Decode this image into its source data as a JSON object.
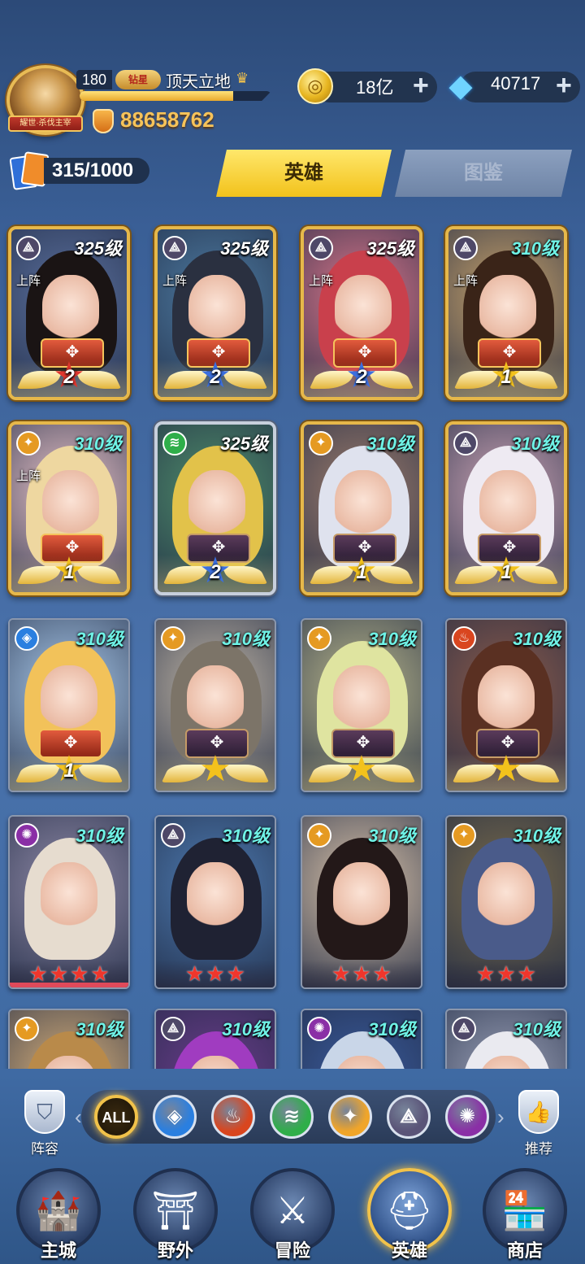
{
  "player": {
    "level": "180",
    "vip_label": "钻星",
    "nickname": "顶天立地",
    "title_banner": "耀世·杀伐主宰",
    "exp_fraction": 0.8,
    "power": "88658762"
  },
  "resources": {
    "gold": "18亿",
    "gems": "40717",
    "plus": "+"
  },
  "deck": {
    "count": "315/1000"
  },
  "tabs": [
    {
      "label": "英雄",
      "active": true
    },
    {
      "label": "图鉴",
      "active": false
    }
  ],
  "heroes": [
    {
      "level": "325级",
      "faction": "void-icon",
      "deployed": "上阵",
      "rank": "2",
      "rank_color": "red",
      "frame": "gold",
      "hair": "#1a1414",
      "bg": "#5a6f9c"
    },
    {
      "level": "325级",
      "faction": "void-icon",
      "deployed": "上阵",
      "rank": "2",
      "rank_color": "blue",
      "frame": "gold",
      "hair": "#2a3040",
      "bg": "#4d7aa0"
    },
    {
      "level": "325级",
      "faction": "void-icon",
      "deployed": "上阵",
      "rank": "2",
      "rank_color": "blue",
      "frame": "gold",
      "hair": "#c9404c",
      "bg": "#d9768a"
    },
    {
      "level": "310级",
      "faction": "void-icon",
      "deployed": "上阵",
      "rank": "1",
      "rank_color": "gold",
      "frame": "gold",
      "hair": "#3a2418",
      "bg": "#c7a16a"
    },
    {
      "level": "310级",
      "faction": "light-icon",
      "deployed": "上阵",
      "rank": "1",
      "rank_color": "gold",
      "frame": "gold",
      "hair": "#eed7a0",
      "bg": "#e9c3c8"
    },
    {
      "level": "325级",
      "faction": "nature-icon",
      "deployed": "",
      "rank": "2",
      "rank_color": "blue",
      "frame": "silver",
      "hair": "#e2c24a",
      "bg": "#4f8c6a"
    },
    {
      "level": "310级",
      "faction": "light-icon",
      "deployed": "",
      "rank": "1",
      "rank_color": "gold",
      "frame": "gold",
      "hair": "#dfe2ee",
      "bg": "#9b7b6b"
    },
    {
      "level": "310级",
      "faction": "void-icon",
      "deployed": "",
      "rank": "1",
      "rank_color": "gold",
      "frame": "gold",
      "hair": "#eeeaf2",
      "bg": "#caa3b3"
    },
    {
      "level": "310级",
      "faction": "water-icon",
      "deployed": "",
      "rank": "1",
      "rank_color": "gold",
      "frame": "plain",
      "hair": "#f2c25a",
      "bg": "#a9c9ea"
    },
    {
      "level": "310级",
      "faction": "light-icon",
      "deployed": "",
      "rank": "",
      "rank_color": "gold",
      "frame": "plain",
      "hair": "#7c7468",
      "bg": "#bfb4a4"
    },
    {
      "level": "310级",
      "faction": "light-icon",
      "deployed": "",
      "rank": "",
      "rank_color": "gold",
      "frame": "plain",
      "hair": "#dfe4a0",
      "bg": "#b8b58a"
    },
    {
      "level": "310级",
      "faction": "fire-icon",
      "deployed": "",
      "rank": "",
      "rank_color": "gold",
      "frame": "plain",
      "hair": "#5a3022",
      "bg": "#8a5a4a"
    },
    {
      "level": "310级",
      "faction": "dark-icon",
      "deployed": "",
      "stars": 4,
      "frame": "plain",
      "hair": "#e6dccf",
      "bg": "#8f89a6"
    },
    {
      "level": "310级",
      "faction": "void-icon",
      "deployed": "",
      "stars": 3,
      "frame": "plain",
      "hair": "#1f2233",
      "bg": "#4d7ab0"
    },
    {
      "level": "310级",
      "faction": "light-icon",
      "deployed": "",
      "stars": 3,
      "frame": "plain",
      "hair": "#231818",
      "bg": "#d9c2a8"
    },
    {
      "level": "310级",
      "faction": "light-icon",
      "deployed": "",
      "stars": 3,
      "frame": "plain",
      "hair": "#4a5b8a",
      "bg": "#7a6b4a"
    },
    {
      "level": "310级",
      "faction": "light-icon",
      "deployed": "",
      "frame": "plain",
      "hair": "#b98a4a",
      "bg": "#d8b07a"
    },
    {
      "level": "310级",
      "faction": "void-icon",
      "deployed": "",
      "frame": "plain",
      "hair": "#a03cc0",
      "bg": "#6a3c8a"
    },
    {
      "level": "310级",
      "faction": "dark-icon",
      "deployed": "",
      "frame": "plain",
      "hair": "#c9d6e8",
      "bg": "#3a5a9a"
    },
    {
      "level": "310级",
      "faction": "void-icon",
      "deployed": "",
      "frame": "plain",
      "hair": "#eaeaf0",
      "bg": "#9aa0b6"
    }
  ],
  "filters": [
    {
      "label": "ALL",
      "icon": "all-icon",
      "active": true
    },
    {
      "icon": "water-icon",
      "color": "#2a7fe0"
    },
    {
      "icon": "fire-icon",
      "color": "#d9461f"
    },
    {
      "icon": "nature-icon",
      "color": "#2fae4a"
    },
    {
      "icon": "light-icon",
      "color": "#f0a52a"
    },
    {
      "icon": "void-icon",
      "color": "#5a5478"
    },
    {
      "icon": "dark-icon",
      "color": "#8a2fa6"
    }
  ],
  "side": {
    "lineup": "阵容",
    "recommend": "推荐"
  },
  "nav": [
    {
      "label": "主城",
      "icon": "castle-icon"
    },
    {
      "label": "野外",
      "icon": "portal-icon"
    },
    {
      "label": "冒险",
      "icon": "sword-icon"
    },
    {
      "label": "英雄",
      "icon": "helmet-icon",
      "active": true
    },
    {
      "label": "商店",
      "icon": "shop-icon"
    }
  ],
  "colors": {
    "accent_gold": "#f2c21b",
    "level_teal": "#6ff2e6",
    "panel_dark": "#22344f"
  }
}
